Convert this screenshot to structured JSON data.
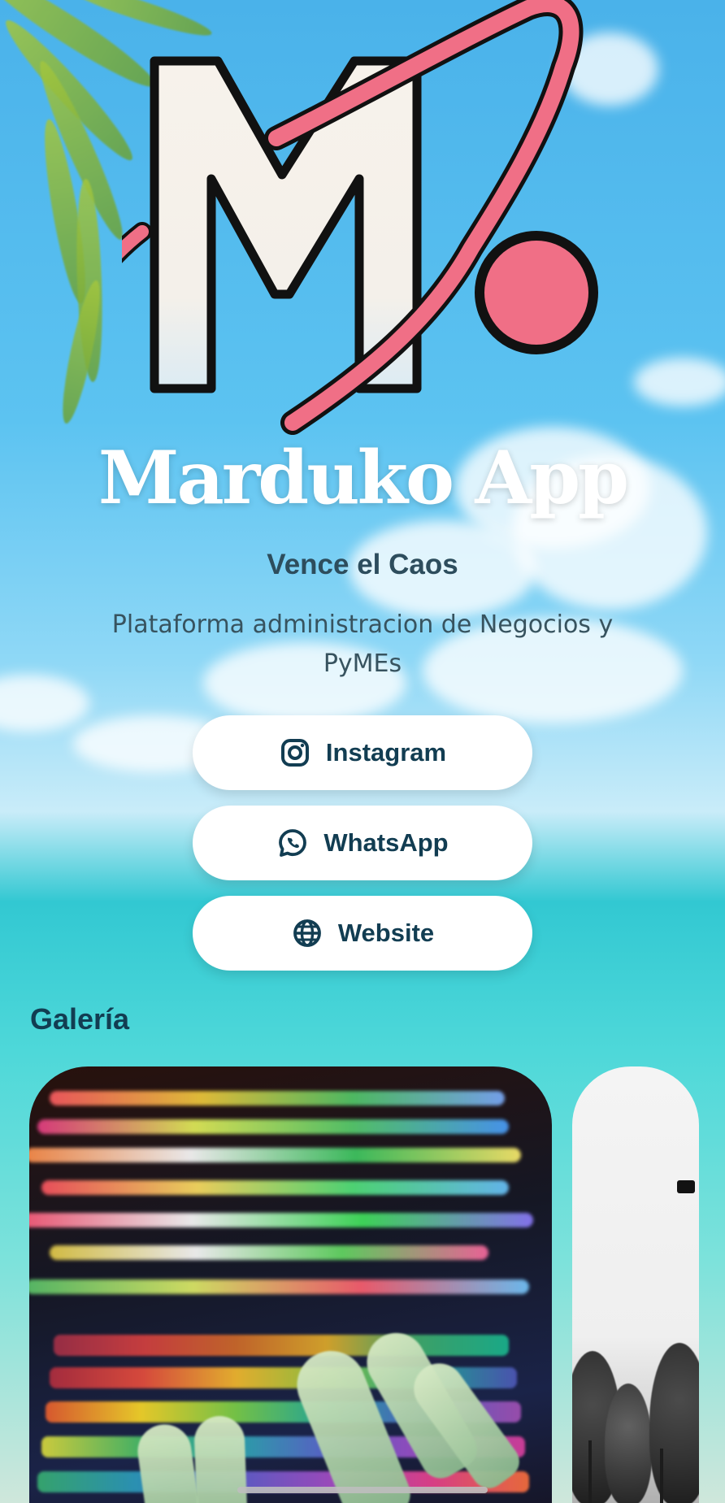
{
  "profile": {
    "title": "Marduko App",
    "tagline": "Vence el Caos",
    "description": "Plataforma administracion de Negocios y PyMEs"
  },
  "links": [
    {
      "label": "Instagram",
      "icon": "instagram-icon"
    },
    {
      "label": "WhatsApp",
      "icon": "whatsapp-icon"
    },
    {
      "label": "Website",
      "icon": "globe-icon"
    }
  ],
  "gallery": {
    "title": "Galería",
    "items": [
      {
        "name": "code-keyboard-image"
      },
      {
        "name": "trees-sky-image"
      }
    ]
  },
  "colors": {
    "accent_pink": "#f06f86",
    "text_dark": "#123d52",
    "button_bg": "#ffffff"
  }
}
